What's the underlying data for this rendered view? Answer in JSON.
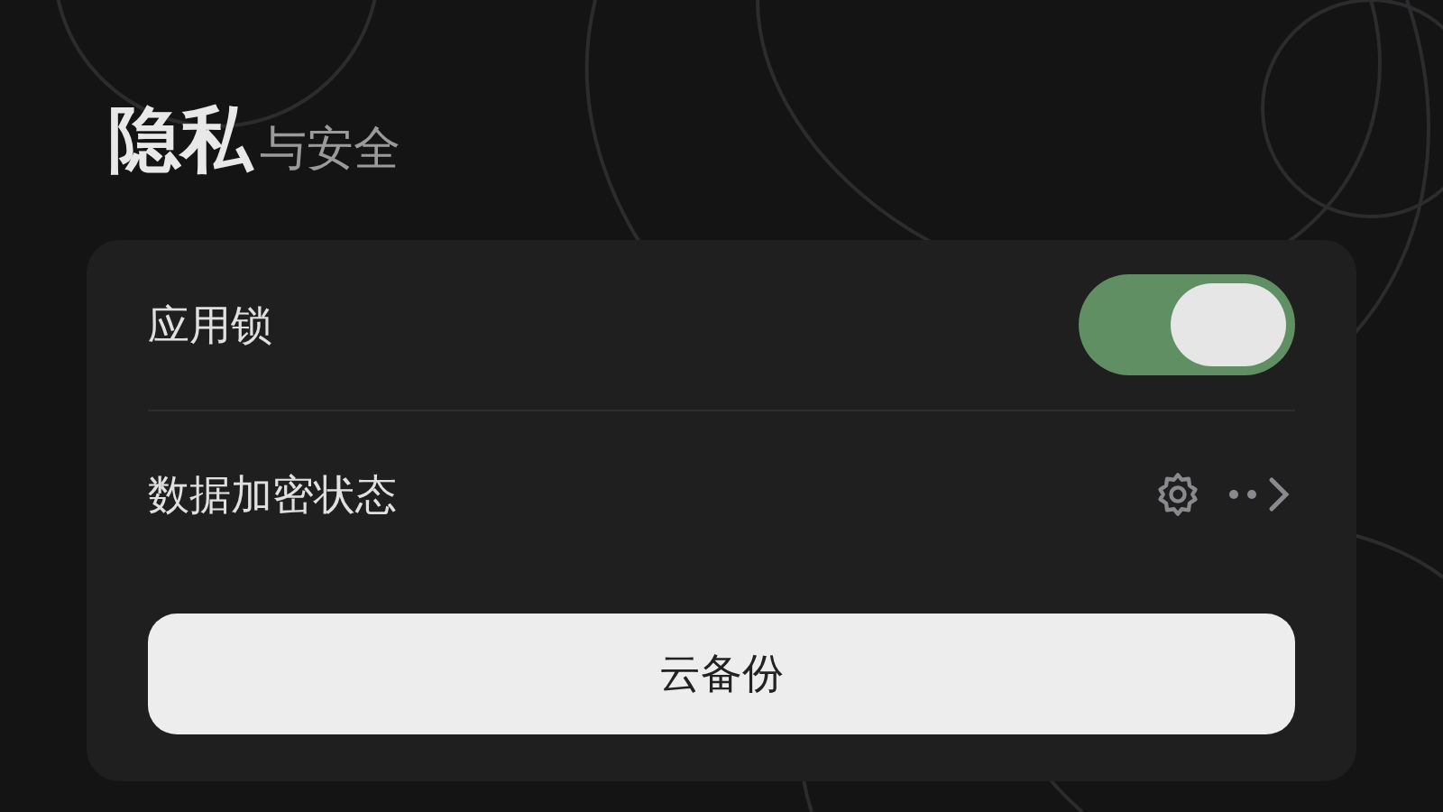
{
  "header": {
    "title": "隐私",
    "subtitle": "与安全"
  },
  "rows": [
    {
      "kind": "toggle",
      "label": "应用锁",
      "on": true
    },
    {
      "kind": "link",
      "label": "数据加密状态"
    }
  ],
  "button": {
    "label": "云备份"
  }
}
